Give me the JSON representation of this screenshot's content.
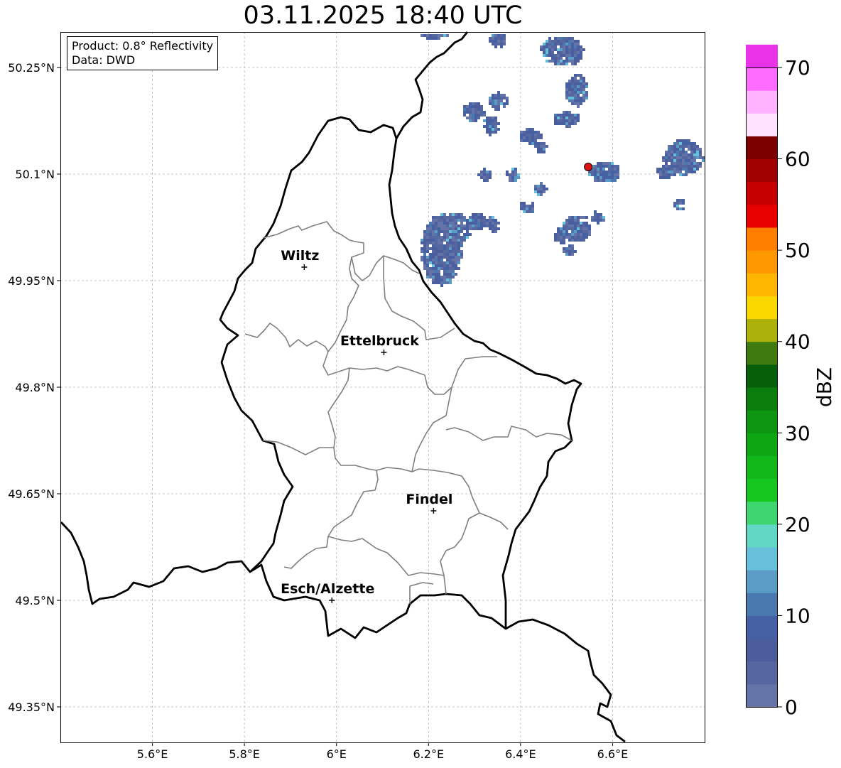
{
  "title": "03.11.2025 18:40 UTC",
  "info": {
    "product": "Product: 0.8° Reflectivity",
    "data_source": "Data: DWD"
  },
  "map_extent": {
    "lon_min": 5.4,
    "lon_max": 6.8,
    "lat_min": 49.3,
    "lat_max": 50.3
  },
  "axes": {
    "x_ticks": [
      {
        "value": 5.6,
        "label": "5.6°E"
      },
      {
        "value": 5.8,
        "label": "5.8°E"
      },
      {
        "value": 6.0,
        "label": "6°E"
      },
      {
        "value": 6.2,
        "label": "6.2°E"
      },
      {
        "value": 6.4,
        "label": "6.4°E"
      },
      {
        "value": 6.6,
        "label": "6.6°E"
      }
    ],
    "y_ticks": [
      {
        "value": 50.25,
        "label": "50.25°N"
      },
      {
        "value": 50.1,
        "label": "50.1°N"
      },
      {
        "value": 49.95,
        "label": "49.95°N"
      },
      {
        "value": 49.8,
        "label": "49.8°N"
      },
      {
        "value": 49.65,
        "label": "49.65°N"
      },
      {
        "value": 49.5,
        "label": "49.5°N"
      },
      {
        "value": 49.35,
        "label": "49.35°N"
      }
    ],
    "grid": true
  },
  "cities": [
    {
      "name": "Wiltz",
      "lon": 5.93,
      "lat": 49.969
    },
    {
      "name": "Ettelbruck",
      "lon": 6.103,
      "lat": 49.849
    },
    {
      "name": "Findel",
      "lon": 6.211,
      "lat": 49.626
    },
    {
      "name": "Esch/Alzette",
      "lon": 5.99,
      "lat": 49.5
    }
  ],
  "radar_site": {
    "lon": 6.547,
    "lat": 50.11,
    "color": "#e01010"
  },
  "colorbar": {
    "label": "dBZ",
    "min": 0,
    "max": 70,
    "step": 2.5,
    "colors": [
      "#6473a8",
      "#56669f",
      "#4b5d9c",
      "#4560a3",
      "#4a79b0",
      "#5a9cc6",
      "#66c0db",
      "#62d8c4",
      "#3ed66e",
      "#16c71f",
      "#12b71a",
      "#0fa614",
      "#0d9410",
      "#0a7d0d",
      "#075f0a",
      "#3f7a0e",
      "#adb20a",
      "#fbd700",
      "#ffb600",
      "#ff9800",
      "#ff7e00",
      "#e70000",
      "#c60000",
      "#a00000",
      "#7c0000",
      "#ffe2ff",
      "#ffb2ff",
      "#ff6cff",
      "#e833e8"
    ],
    "ticks": [
      0,
      10,
      20,
      30,
      40,
      50,
      60,
      70
    ]
  }
}
